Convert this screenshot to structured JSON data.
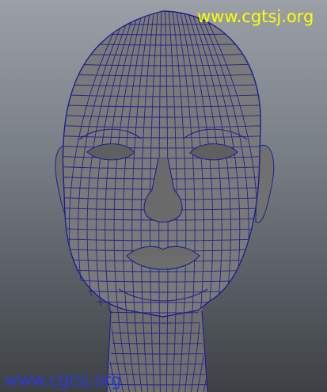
{
  "viewport": {
    "background_top": "#9aa0a6",
    "background_bottom": "#3d4146"
  },
  "model": {
    "subject": "head",
    "surface_color": "#7a7a7a",
    "wire_color": "#1f1f8f"
  },
  "watermarks": {
    "top": {
      "text": "www.cgtsj.org",
      "color": "#ffff00"
    },
    "bottom": {
      "text": "www.cgtsj.org",
      "color": "#2a39d6"
    }
  }
}
